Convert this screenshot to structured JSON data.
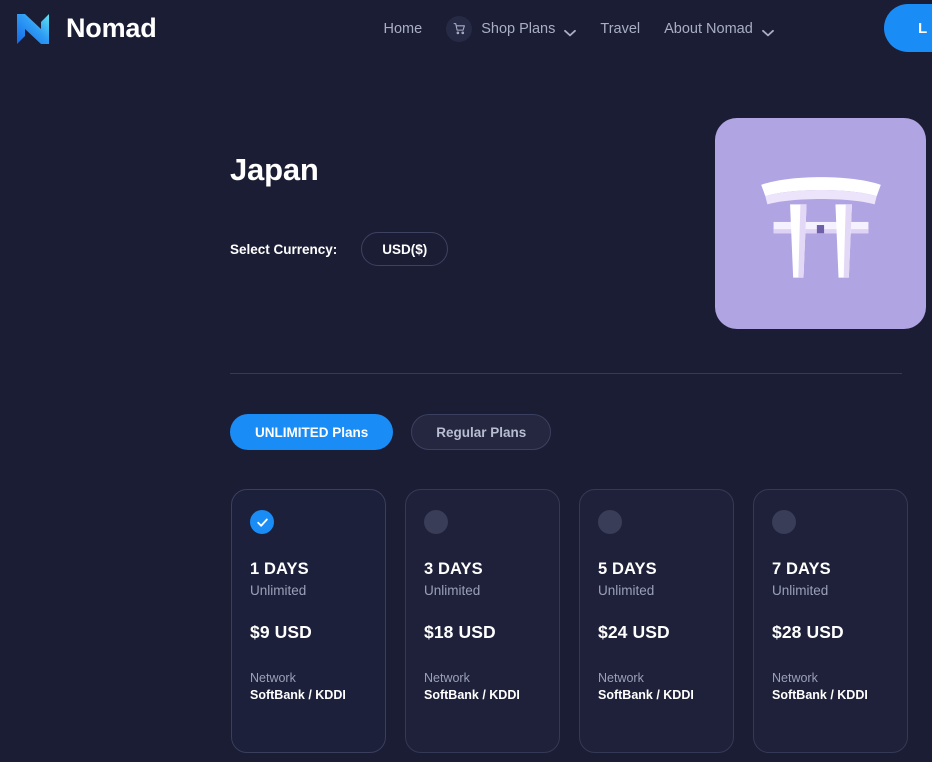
{
  "header": {
    "brand_name": "Nomad",
    "brand_logo_icon": "nomad-n-logo",
    "nav": [
      {
        "label": "Home",
        "icon": null,
        "caret": false
      },
      {
        "label": "Shop Plans",
        "icon": "cart-icon",
        "caret": true
      },
      {
        "label": "Travel",
        "icon": null,
        "caret": false
      },
      {
        "label": "About Nomad",
        "icon": null,
        "caret": true
      }
    ],
    "login_label": "L"
  },
  "hero": {
    "title": "Japan",
    "currency_label": "Select Currency:",
    "currency_value": "USD($)",
    "country_art_icon": "torii-gate-icon"
  },
  "plan_tabs": [
    {
      "label": "UNLIMITED Plans",
      "active": true
    },
    {
      "label": "Regular Plans",
      "active": false
    }
  ],
  "plans": [
    {
      "days": "1 DAYS",
      "data": "Unlimited",
      "price": "$9 USD",
      "network_label": "Network",
      "network_value": "SoftBank / KDDI",
      "selected": true
    },
    {
      "days": "3 DAYS",
      "data": "Unlimited",
      "price": "$18 USD",
      "network_label": "Network",
      "network_value": "SoftBank / KDDI",
      "selected": false
    },
    {
      "days": "5 DAYS",
      "data": "Unlimited",
      "price": "$24 USD",
      "network_label": "Network",
      "network_value": "SoftBank / KDDI",
      "selected": false
    },
    {
      "days": "7 DAYS",
      "data": "Unlimited",
      "price": "$28 USD",
      "network_label": "Network",
      "network_value": "SoftBank / KDDI",
      "selected": false
    }
  ],
  "colors": {
    "background": "#1b1d34",
    "accent": "#1a8cf5",
    "card": "#1e2139",
    "card_border": "#353955",
    "muted_text": "#9ba0b8",
    "art_background": "#b0a4e3"
  }
}
